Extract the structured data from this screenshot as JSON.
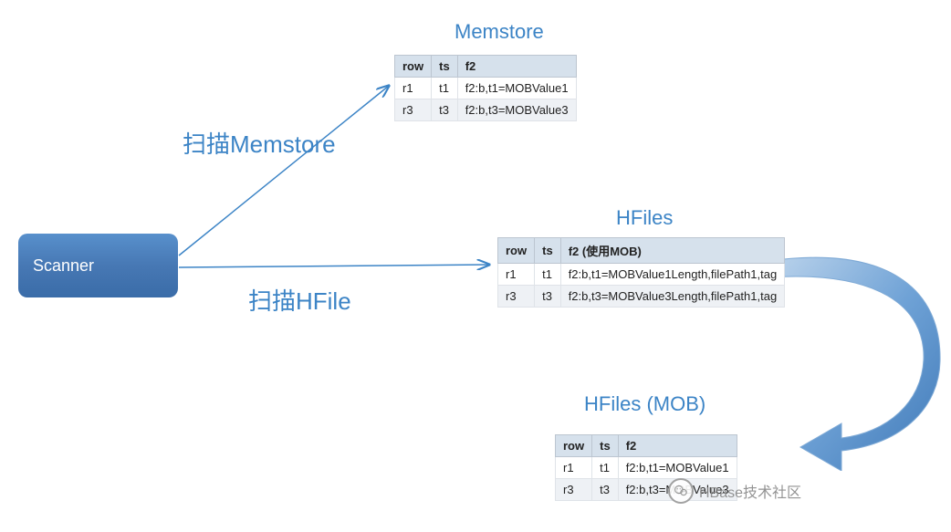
{
  "scanner": {
    "label": "Scanner"
  },
  "labels": {
    "scan_memstore": "扫描Memstore",
    "scan_hfile": "扫描HFile"
  },
  "titles": {
    "memstore": "Memstore",
    "hfiles": "HFiles",
    "hfiles_mob": "HFiles (MOB)"
  },
  "tables": {
    "memstore": {
      "headers": [
        "row",
        "ts",
        "f2"
      ],
      "rows": [
        [
          "r1",
          "t1",
          "f2:b,t1=MOBValue1"
        ],
        [
          "r3",
          "t3",
          "f2:b,t3=MOBValue3"
        ]
      ]
    },
    "hfiles": {
      "headers": [
        "row",
        "ts",
        "f2 (使用MOB)"
      ],
      "rows": [
        [
          "r1",
          "t1",
          "f2:b,t1=MOBValue1Length,filePath1,tag"
        ],
        [
          "r3",
          "t3",
          "f2:b,t3=MOBValue3Length,filePath1,tag"
        ]
      ]
    },
    "hfiles_mob": {
      "headers": [
        "row",
        "ts",
        "f2"
      ],
      "rows": [
        [
          "r1",
          "t1",
          "f2:b,t1=MOBValue1"
        ],
        [
          "r3",
          "t3",
          "f2:b,t3=MOBValue3"
        ]
      ]
    }
  },
  "watermark": {
    "text": "HBase技术社区"
  }
}
